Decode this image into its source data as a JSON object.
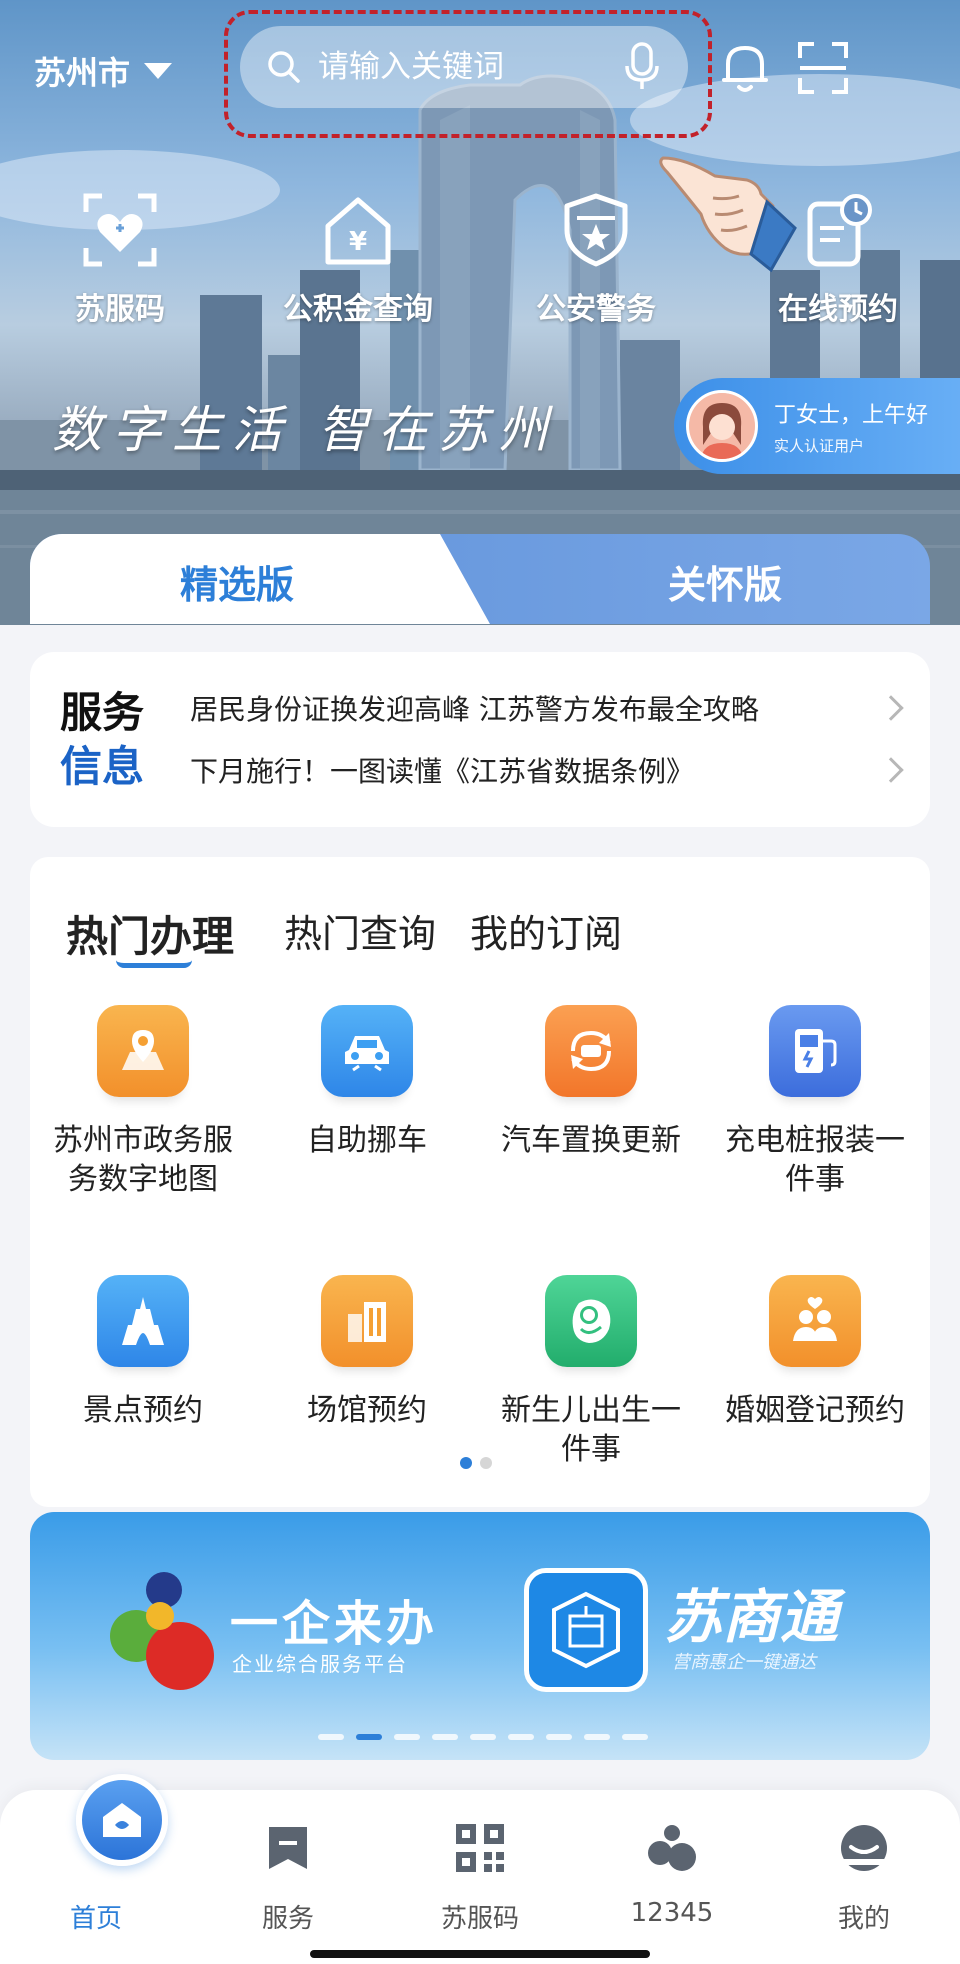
{
  "header": {
    "city": "苏州市",
    "search_placeholder": "请输入关键词"
  },
  "quick_actions": [
    {
      "label": "苏服码",
      "icon": "health-code-icon"
    },
    {
      "label": "公积金查询",
      "icon": "house-fund-icon"
    },
    {
      "label": "公安警务",
      "icon": "police-shield-icon"
    },
    {
      "label": "在线预约",
      "icon": "appointment-icon"
    }
  ],
  "slogan": "数字生活 智在苏州",
  "user": {
    "greeting": "丁女士，上午好",
    "status": "实人认证用户"
  },
  "version_tabs": {
    "active": "精选版",
    "inactive": "关怀版"
  },
  "service_info": {
    "title_line1": "服务",
    "title_line2": "信息",
    "items": [
      "居民身份证换发迎高峰 江苏警方发布最全攻略",
      "下月施行！一图读懂《江苏省数据条例》"
    ]
  },
  "hot": {
    "tabs": [
      "热门办理",
      "热门查询",
      "我的订阅"
    ],
    "services": [
      {
        "label": "苏州市政务服务数字地图",
        "icon": "map-pin-icon",
        "color": "#f5a033"
      },
      {
        "label": "自助挪车",
        "icon": "car-icon",
        "color": "#3d9ff2"
      },
      {
        "label": "汽车置换更新",
        "icon": "car-exchange-icon",
        "color": "#f58a35"
      },
      {
        "label": "充电桩报装一件事",
        "icon": "charging-pile-icon",
        "color": "#4a7fe6"
      },
      {
        "label": "景点预约",
        "icon": "tower-icon",
        "color": "#3d9ff2"
      },
      {
        "label": "场馆预约",
        "icon": "venue-icon",
        "color": "#f5a033"
      },
      {
        "label": "新生儿出生一件事",
        "icon": "newborn-icon",
        "color": "#33c07f"
      },
      {
        "label": "婚姻登记预约",
        "icon": "couple-icon",
        "color": "#f5a033"
      }
    ]
  },
  "banner": {
    "left_title": "一企来办",
    "left_subtitle": "企业综合服务平台",
    "right_title": "苏商通",
    "right_subtitle": "营商惠企一键通达"
  },
  "bottom_nav": [
    {
      "label": "首页",
      "icon": "home-icon",
      "active": true
    },
    {
      "label": "服务",
      "icon": "bookmark-icon",
      "active": false
    },
    {
      "label": "苏服码",
      "icon": "qr-code-icon",
      "active": false
    },
    {
      "label": "12345",
      "icon": "hotline-icon",
      "active": false
    },
    {
      "label": "我的",
      "icon": "profile-icon",
      "active": false
    }
  ]
}
